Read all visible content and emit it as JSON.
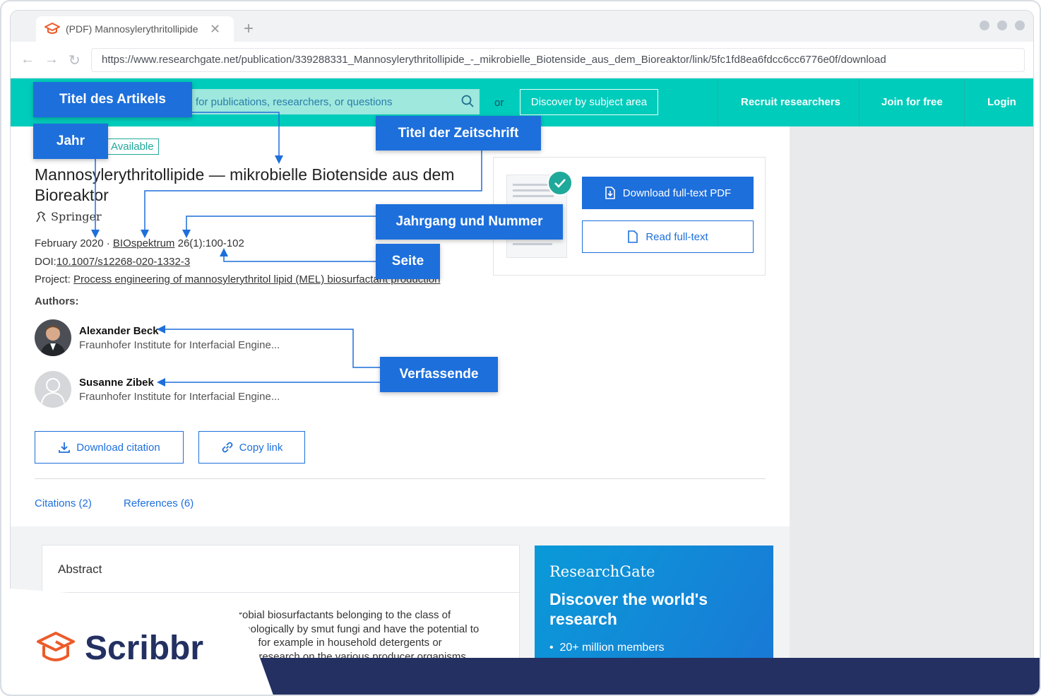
{
  "browser": {
    "tab_title": "(PDF) Mannosylerythritollipide",
    "url": "https://www.researchgate.net/publication/339288331_Mannosylerythritollipide_-_mikrobielle_Biotenside_aus_dem_Bioreaktor/link/5fc1fd8ea6fdcc6cc6776e0f/download"
  },
  "header": {
    "search_placeholder": "for publications, researchers, or questions",
    "or_label": "or",
    "discover_label": "Discover by subject area",
    "recruit_label": "Recruit researchers",
    "join_label": "Join for free",
    "login_label": "Login",
    "accent_color": "#00ccbb"
  },
  "article": {
    "available_badge": "Available",
    "title": "Mannosylerythritollipide — mikrobielle Biotenside aus dem Bioreaktor",
    "publisher": "Springer",
    "date": "February 2020",
    "dot": "·",
    "journal": "BIOspektrum",
    "volume_pages": "26(1):100-102",
    "doi_label": "DOI:",
    "doi": "10.1007/s12268-020-1332-3",
    "project_label": "Project:",
    "project": "Process engineering of mannosylerythritol lipid (MEL) biosurfactant production",
    "authors_heading": "Authors:",
    "authors": [
      {
        "name": "Alexander Beck",
        "affiliation": "Fraunhofer Institute for Interfacial Engine..."
      },
      {
        "name": "Susanne Zibek",
        "affiliation": "Fraunhofer Institute for Interfacial Engine..."
      }
    ],
    "download_citation": "Download citation",
    "copy_link": "Copy link",
    "citations_tab": "Citations (2)",
    "references_tab": "References (6)"
  },
  "pdf_card": {
    "download_pdf": "Download full-text PDF",
    "read_fulltext": "Read full-text"
  },
  "abstract": {
    "heading": "Abstract",
    "lines": [
      "robial biosurfactants belonging to the class of",
      "nnologically by smut fungi and have the potential to",
      "cts, for example in household detergents or",
      "test research on the various producer organisms"
    ]
  },
  "promo": {
    "brand": "ResearchGate",
    "headline": "Discover the world's research",
    "item": "20+ million members"
  },
  "annotations": {
    "title_label": "Titel des Artikels",
    "year_label": "Jahr",
    "journal_label": "Titel der Zeitschrift",
    "volume_label": "Jahrgang und Nummer",
    "page_label": "Seite",
    "authors_label": "Verfassende"
  },
  "branding": {
    "wordmark": "Scribbr",
    "brand_color": "#233061",
    "annotation_color": "#1d6fdc"
  }
}
